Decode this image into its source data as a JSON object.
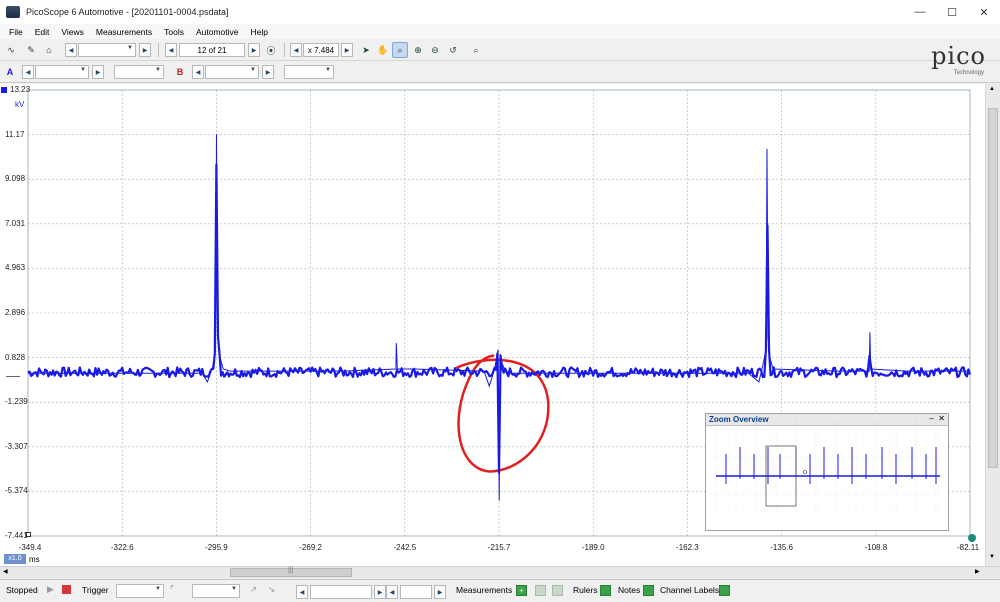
{
  "window": {
    "title": "PicoScope 6 Automotive - [20201101-0004.psdata]"
  },
  "menu": [
    "File",
    "Edit",
    "Views",
    "Measurements",
    "Tools",
    "Automotive",
    "Help"
  ],
  "toolbar": {
    "buffer_position": "12 of 21",
    "zoom_value": "x 7.484",
    "channel_a": "A",
    "channel_b": "B"
  },
  "logo": {
    "word": "pico",
    "sub": "Technology"
  },
  "scope": {
    "y_unit": "kV",
    "y_ticks": [
      "13.23",
      "11.17",
      "9.098",
      "7.031",
      "4.963",
      "2.896",
      "0.828",
      "-1.239",
      "-3.307",
      "-5.374",
      "-7.441"
    ],
    "x_ticks": [
      "-349.4",
      "-322.6",
      "-295.9",
      "-269.2",
      "-242.5",
      "-215.7",
      "-189.0",
      "-162.3",
      "-135.6",
      "-108.8",
      "-82.11"
    ],
    "x_unit": "ms",
    "x_scale_badge": "x1.0",
    "trace_color": "#1a1ae6",
    "annotation_color": "#e02020"
  },
  "chart_data": {
    "type": "line",
    "xlabel": "ms",
    "ylabel": "kV",
    "xlim": [
      -349.4,
      -82.11
    ],
    "ylim": [
      -7.441,
      13.23
    ],
    "grid": true,
    "series": [
      {
        "x": [
          -349.4,
          -300,
          -298.5,
          -297,
          -296.2,
          -295.9,
          -295.6,
          -295,
          -294,
          -292,
          -260,
          -245,
          -244.9,
          -244.6,
          -240,
          -220,
          -218.5,
          -217,
          -216,
          -215.7,
          -215.4,
          -215,
          -214,
          -212,
          -200,
          -190,
          -180,
          -165,
          -145,
          -142,
          -141,
          -140,
          -139.7,
          -139.4,
          -139,
          -138,
          -120,
          -110.7,
          -110.5,
          -110.3,
          -100,
          -82.11
        ],
        "y": [
          0.1,
          0.1,
          -0.3,
          0.4,
          1.2,
          11.17,
          2.0,
          0.9,
          0.3,
          0.2,
          0.2,
          0.3,
          1.5,
          0.3,
          0.3,
          0.2,
          -0.5,
          0.3,
          1.2,
          -5.8,
          1.0,
          0.6,
          0.2,
          0.1,
          0.1,
          0.1,
          0.1,
          0.1,
          0.1,
          -0.3,
          0.4,
          1.2,
          10.5,
          1.8,
          0.9,
          0.3,
          0.2,
          0.2,
          2.0,
          0.3,
          0.2,
          0.2
        ]
      }
    ]
  },
  "zoom_overview": {
    "title": "Zoom Overview"
  },
  "statusbar": {
    "run_state": "Stopped",
    "trigger_label": "Trigger",
    "measurements_label": "Measurements",
    "rulers_label": "Rulers",
    "notes_label": "Notes",
    "channel_labels_label": "Channel Labels"
  }
}
